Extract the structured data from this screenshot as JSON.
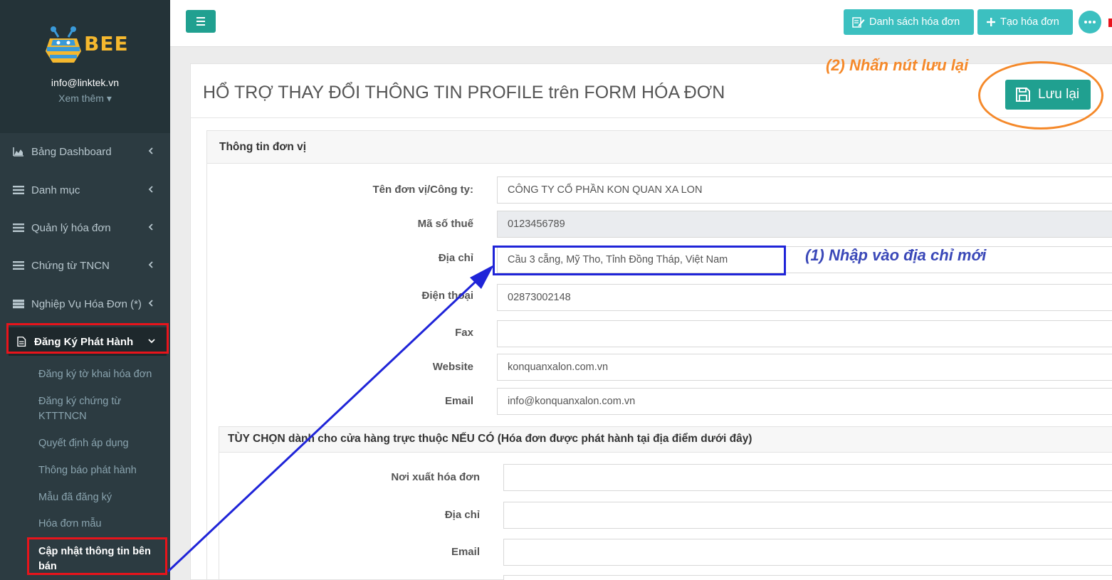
{
  "brand": {
    "name": "BEE",
    "email": "info@linktek.vn",
    "more": "Xem thêm"
  },
  "sidebar": {
    "items": [
      {
        "label": "Bảng Dashboard",
        "icon": "area-chart-icon"
      },
      {
        "label": "Danh mục",
        "icon": "list-icon"
      },
      {
        "label": "Quản lý hóa đơn",
        "icon": "list-icon"
      },
      {
        "label": "Chứng từ TNCN",
        "icon": "list-icon"
      },
      {
        "label": "Nghiệp Vụ Hóa Đơn (*)",
        "icon": "server-icon"
      },
      {
        "label": "Đăng Ký Phát Hành",
        "icon": "file-icon"
      }
    ],
    "sub_items": [
      "Đăng ký tờ khai hóa đơn",
      "Đăng ký chứng từ KTTTNCN",
      "Quyết định áp dụng",
      "Thông báo phát hành",
      "Mẫu đã đăng ký",
      "Hóa đơn mẫu",
      "Cập nhật thông tin bên bán"
    ]
  },
  "topbar": {
    "list_label": "Danh sách hóa đơn",
    "create_label": "Tạo hóa đơn"
  },
  "page": {
    "title": "HỔ TRỢ THAY ĐỔI THÔNG TIN PROFILE trên FORM HÓA ĐƠN",
    "save_label": "Lưu lại"
  },
  "annotations": {
    "step1": "(1) Nhập vào địa chỉ mới",
    "step2": "(2) Nhấn nút lưu lại"
  },
  "form": {
    "section_title": "Thông tin đơn vị",
    "fields": [
      {
        "label": "Tên đơn vị/Công ty:",
        "value": "CÔNG TY CỔ PHẦN KON QUAN XA LON"
      },
      {
        "label": "Mã số thuế",
        "value": "0123456789"
      },
      {
        "label": "Địa chỉ",
        "value": "Cầu 3 cẵng, Mỹ Tho, Tỉnh Đồng Tháp, Việt Nam"
      },
      {
        "label": "Điện thoại",
        "value": "02873002148"
      },
      {
        "label": "Fax",
        "value": ""
      },
      {
        "label": "Website",
        "value": "konquanxalon.com.vn"
      },
      {
        "label": "Email",
        "value": "info@konquanxalon.com.vn"
      }
    ],
    "option_title": "TÙY CHỌN dành cho cửa hàng trực thuộc NẾU CÓ (Hóa đơn được phát hành tại địa điểm dưới đây)",
    "option_fields": [
      {
        "label": "Nơi xuất hóa đơn"
      },
      {
        "label": "Địa chỉ"
      },
      {
        "label": "Email"
      }
    ]
  }
}
